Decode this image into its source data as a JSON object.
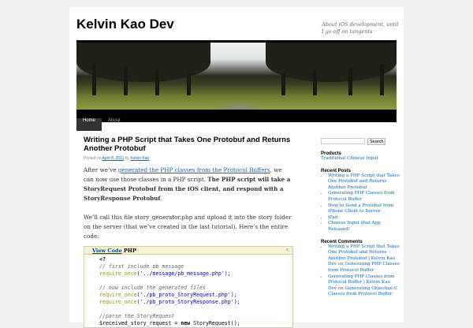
{
  "site": {
    "title": "Kelvin Kao Dev",
    "description": "About iOS development, until I go off on tangents"
  },
  "nav": [
    {
      "label": "Home"
    },
    {
      "label": "About"
    }
  ],
  "post": {
    "title": "Writing a PHP Script that Takes One Protobuf and Returns Another Protobuf",
    "meta_posted": "Posted on",
    "meta_date": "April 8, 2011",
    "meta_by": "by",
    "meta_author": "Kelvin Kao",
    "p1_pre": "After we’ve ",
    "p1_link": "generated the PHP classes from the Protocol Buffers",
    "p1_mid": ", we can now use those classes in a PHP script. ",
    "p1_bold": "The PHP script will take a StoryRequest Protobuf from the iOS client, and respond with a StoryResponse Protobuf",
    "p1_end": ".",
    "p2": "We’ll call this file story_generator.php and upload it into the story folder on the server (that we’ve created in the last tutorial). Here’s the entire code:",
    "code": {
      "view_code": "View Code",
      "lang": "PHP",
      "lines": [
        "<?",
        "// first include pb_message",
        "require_once",
        "('../message/pb_message.php');",
        "// now include the generated files",
        "('./pb_proto_StoryRequest.php');",
        "('./pb_proto_StoryResponse.php');",
        "//parse the StoryRequest",
        "$received_story_request = ",
        "new",
        " StoryRequest();"
      ]
    }
  },
  "sidebar": {
    "search_button": "Search",
    "products_title": "Products",
    "products": [
      "Traditional Chinese Input"
    ],
    "recent_posts_title": "Recent Posts",
    "recent_posts": [
      "Writing a PHP Script that Takes One Protobuf and Returns Another Protobuf",
      "Generating PHP Classes from Protocol Buffer",
      "How to Send a Protobuf from iPhone Client to Server",
      "iPad",
      "Chinese Input iPad App Released!"
    ],
    "recent_comments_title": "Recent Comments",
    "comments": [
      {
        "author": "Writing a PHP Script that Takes One Protobuf and Returns Another Protobuf | Kelvin Kao Dev",
        "on": "on",
        "post": "Generating PHP Classes from Protocol Buffer"
      },
      {
        "author": "Generating PHP Classes from Protocol Buffer | Kelvin Kao Dev",
        "on": "on",
        "post": "Generating Objective-C Classes from Protocol Buffer"
      }
    ]
  }
}
